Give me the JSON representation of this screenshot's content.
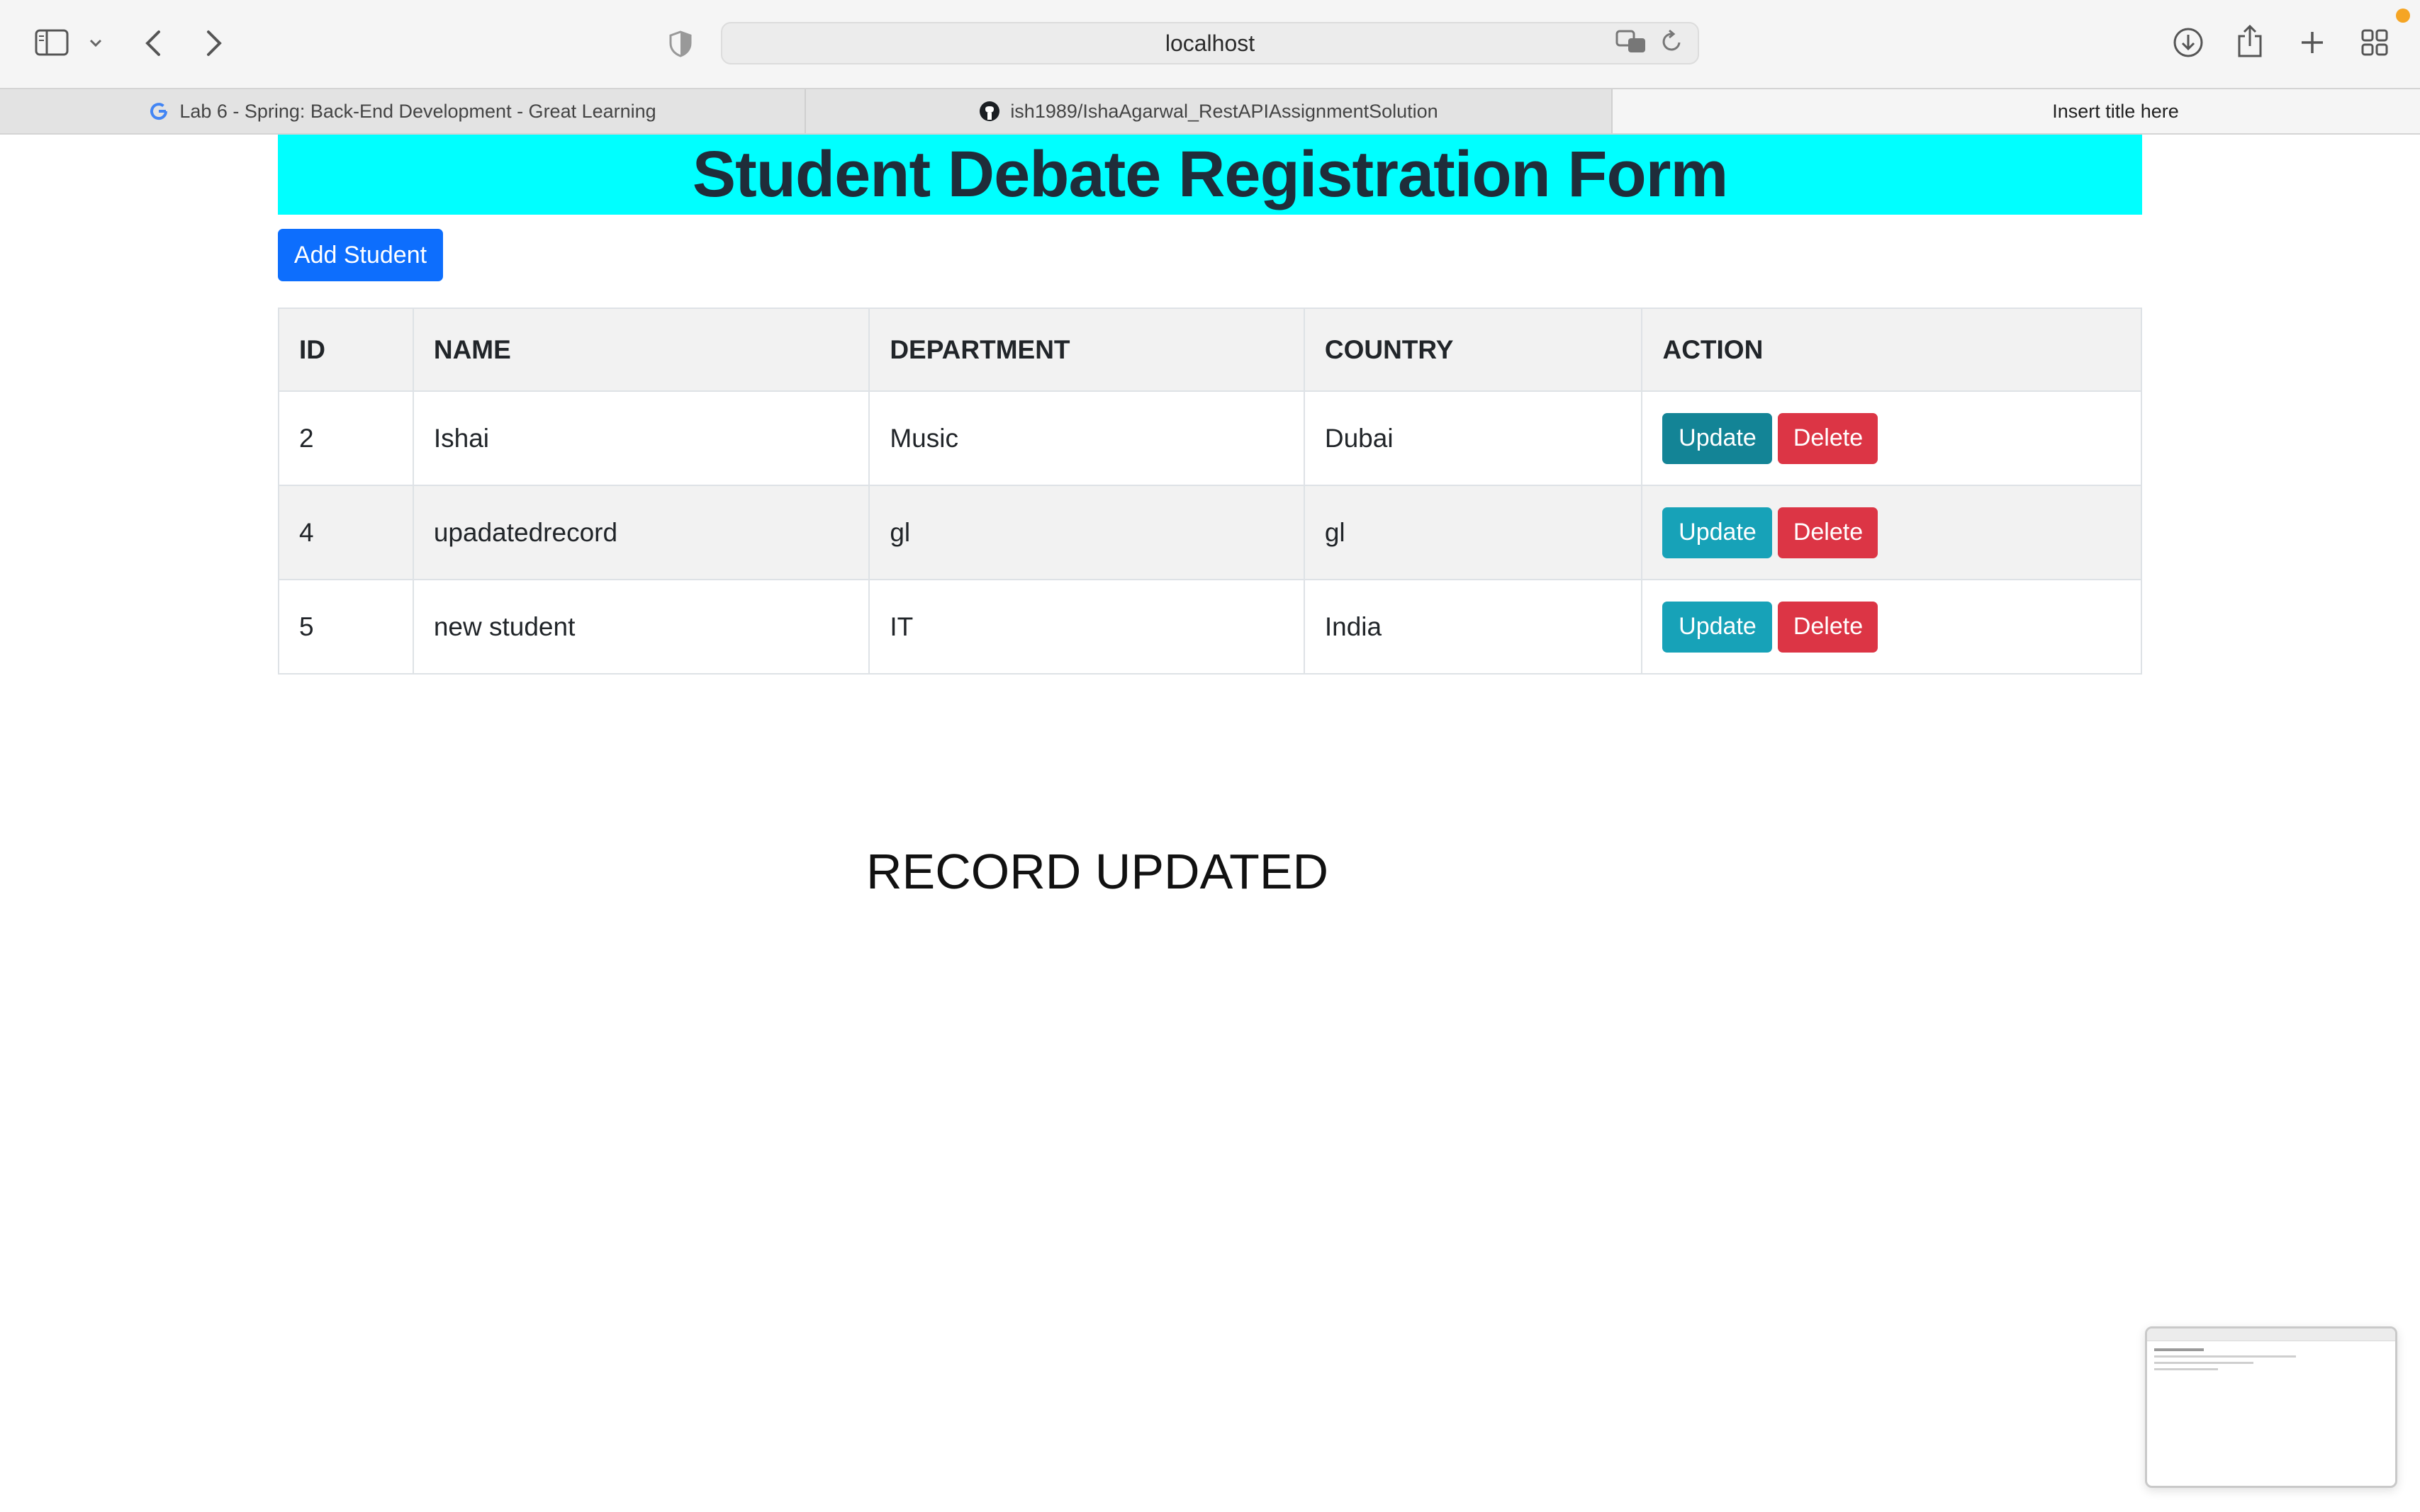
{
  "browser": {
    "url": "localhost",
    "tabs": [
      {
        "label": "Lab 6 - Spring: Back-End Development - Great Learning",
        "favicon": "google-g-icon"
      },
      {
        "label": "ish1989/IshaAgarwal_RestAPIAssignmentSolution",
        "favicon": "github-icon"
      },
      {
        "label": "Insert title here",
        "active": true
      }
    ],
    "icons": [
      "sidebar-icon",
      "chevron-down-icon",
      "back-icon",
      "forward-icon",
      "shield-icon",
      "translate-icon",
      "reload-icon",
      "download-icon",
      "share-icon",
      "plus-icon",
      "tab-overview-icon"
    ]
  },
  "page": {
    "heading": "Student Debate Registration Form",
    "add_button": "Add Student",
    "status_message": "RECORD UPDATED"
  },
  "table": {
    "headers": [
      "ID",
      "NAME",
      "DEPARTMENT",
      "COUNTRY",
      "ACTION"
    ],
    "rows": [
      {
        "id": "2",
        "name": "Ishai",
        "department": "Music",
        "country": "Dubai"
      },
      {
        "id": "4",
        "name": "upadatedrecord",
        "department": "gl",
        "country": "gl"
      },
      {
        "id": "5",
        "name": "new student",
        "department": "IT",
        "country": "India"
      }
    ],
    "update_label": "Update",
    "delete_label": "Delete"
  },
  "colors": {
    "banner": "#00ffff",
    "primary_button": "#0d6efd",
    "update_button": "#17a2b8",
    "delete_button": "#dc3545"
  }
}
